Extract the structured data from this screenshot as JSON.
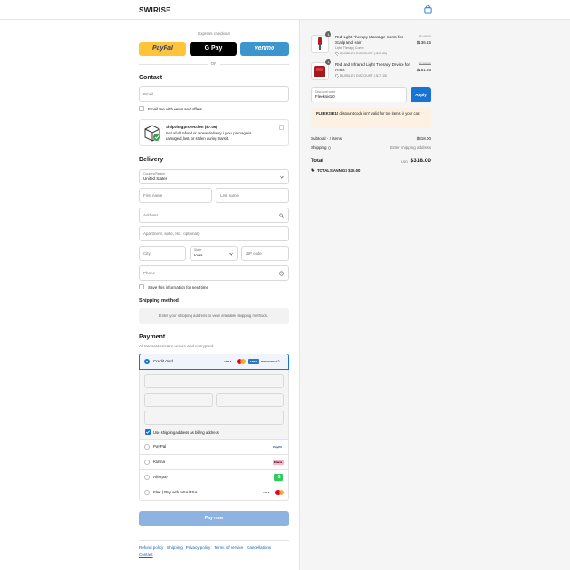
{
  "header": {
    "brand": "SWIRISE",
    "cart_icon": "shopping-bag-icon"
  },
  "express": {
    "title": "Express checkout",
    "or": "OR",
    "paypal": "PayPal",
    "gpay": "G Pay",
    "venmo": "venmo"
  },
  "contact": {
    "title": "Contact",
    "email_placeholder": "Email",
    "news_label": "Email me with news and offers",
    "protection_title": "Shipping protection ($7.06)",
    "protection_desc": "Get a full refund or a new delivery if your package is damaged, lost, or stolen during transit."
  },
  "delivery": {
    "title": "Delivery",
    "country_label": "Country/Region",
    "country_value": "United States",
    "first_name": "First name",
    "last_name": "Last name",
    "address": "Address",
    "apartment": "Apartment, suite, etc. (optional)",
    "city": "City",
    "state_label": "State",
    "state_value": "Iowa",
    "zip": "ZIP code",
    "phone": "Phone",
    "save_label": "Save this information for next time"
  },
  "shipping_method": {
    "title": "Shipping method",
    "placeholder": "Enter your shipping address to view available shipping methods."
  },
  "payment": {
    "title": "Payment",
    "subtitle": "All transactions are secure and encrypted.",
    "credit_card": "Credit card",
    "cards": [
      "VISA",
      "MC",
      "AMEX",
      "DISCOVER"
    ],
    "more": "+2",
    "billing_same": "Use shipping address as billing address",
    "options": [
      {
        "label": "PayPal",
        "badge": "PayPal"
      },
      {
        "label": "Klarna",
        "badge": "Klarna"
      },
      {
        "label": "Afterpay",
        "badge": "$"
      },
      {
        "label": "Flex | Pay with HSA/FSA",
        "badge": "VISA"
      }
    ],
    "pay_now": "Pay now"
  },
  "footer": {
    "links": [
      "Refund policy",
      "Shipping",
      "Privacy policy",
      "Terms of service",
      "Cancellations",
      "Contact"
    ]
  },
  "cart": {
    "items": [
      {
        "qty": "1",
        "name": "Red Light Therapy Massage Comb for Scalp and Hair",
        "variant": "Light Therapy Comb",
        "discount": "BUNDLES DISCOUNT (-$12.85)",
        "old_price": "$149.00",
        "price": "$136.15"
      },
      {
        "qty": "1",
        "name": "Red and Infrared Light Therapy Device for Arms",
        "discount": "BUNDLES DISCOUNT (-$17.15)",
        "old_price": "$199.00",
        "price": "$181.85"
      }
    ],
    "discount_label": "Discount code",
    "discount_value": "Fleeksie10",
    "apply": "Apply",
    "error_code": "FLEEKSIE10",
    "error_msg": "discount code isn't valid for the items in your cart",
    "subtotal_label": "Subtotal · 2 items",
    "subtotal": "$318.00",
    "shipping_label": "Shipping",
    "shipping_value": "Enter shipping address",
    "total_label": "Total",
    "currency": "USD",
    "total": "$318.00",
    "savings_label": "TOTAL SAVINGS",
    "savings": "$30.00"
  },
  "colors": {
    "paypal": "#ffc439",
    "venmo": "#3d95ce",
    "accent": "#1773d4",
    "pay_disabled": "#8fb3e0"
  }
}
